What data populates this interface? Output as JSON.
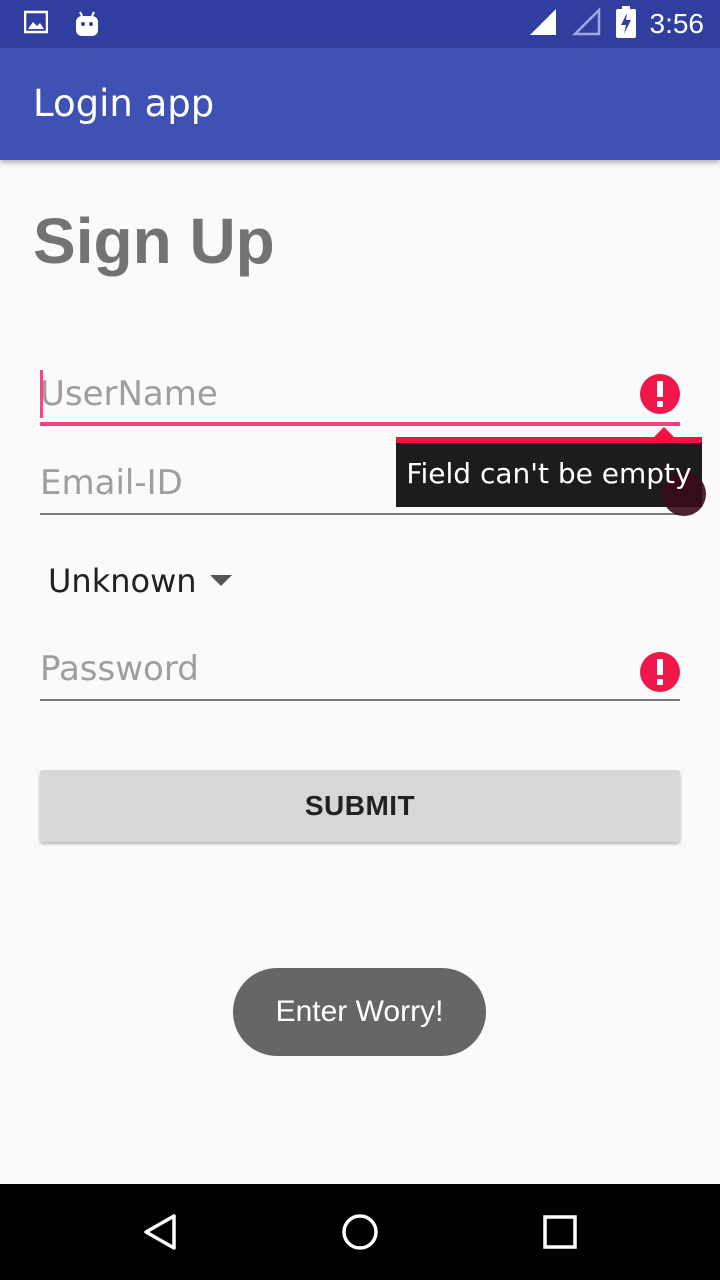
{
  "status_bar": {
    "time": "3:56",
    "icons": [
      "image-notification-icon",
      "android-notification-icon",
      "signal-icon",
      "signal-outline-icon",
      "battery-charging-icon"
    ]
  },
  "app_bar": {
    "title": "Login app"
  },
  "form": {
    "heading": "Sign Up",
    "username": {
      "placeholder": "UserName",
      "value": ""
    },
    "email": {
      "placeholder": "Email-ID",
      "value": ""
    },
    "gender": {
      "selected": "Unknown"
    },
    "password": {
      "placeholder": "Password",
      "value": ""
    },
    "error_tooltip": "Field can't be empty",
    "submit_label": "SUBMIT"
  },
  "toast": {
    "text": "Enter Worry!"
  },
  "nav_bar": {
    "buttons": [
      "back-icon",
      "home-icon",
      "recents-icon"
    ]
  },
  "colors": {
    "primary": "#3f51b5",
    "primary_dark": "#303f9f",
    "accent": "#ff4081",
    "error": "#f0174a"
  }
}
